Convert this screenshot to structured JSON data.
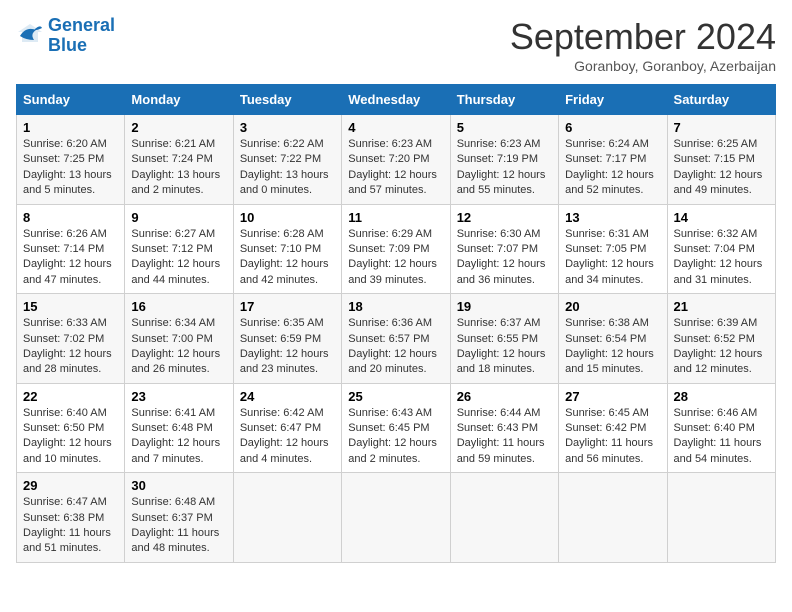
{
  "header": {
    "logo_general": "General",
    "logo_blue": "Blue",
    "month_title": "September 2024",
    "location": "Goranboy, Goranboy, Azerbaijan"
  },
  "days_of_week": [
    "Sunday",
    "Monday",
    "Tuesday",
    "Wednesday",
    "Thursday",
    "Friday",
    "Saturday"
  ],
  "weeks": [
    [
      {
        "day": "1",
        "sunrise": "Sunrise: 6:20 AM",
        "sunset": "Sunset: 7:25 PM",
        "daylight": "Daylight: 13 hours and 5 minutes."
      },
      {
        "day": "2",
        "sunrise": "Sunrise: 6:21 AM",
        "sunset": "Sunset: 7:24 PM",
        "daylight": "Daylight: 13 hours and 2 minutes."
      },
      {
        "day": "3",
        "sunrise": "Sunrise: 6:22 AM",
        "sunset": "Sunset: 7:22 PM",
        "daylight": "Daylight: 13 hours and 0 minutes."
      },
      {
        "day": "4",
        "sunrise": "Sunrise: 6:23 AM",
        "sunset": "Sunset: 7:20 PM",
        "daylight": "Daylight: 12 hours and 57 minutes."
      },
      {
        "day": "5",
        "sunrise": "Sunrise: 6:23 AM",
        "sunset": "Sunset: 7:19 PM",
        "daylight": "Daylight: 12 hours and 55 minutes."
      },
      {
        "day": "6",
        "sunrise": "Sunrise: 6:24 AM",
        "sunset": "Sunset: 7:17 PM",
        "daylight": "Daylight: 12 hours and 52 minutes."
      },
      {
        "day": "7",
        "sunrise": "Sunrise: 6:25 AM",
        "sunset": "Sunset: 7:15 PM",
        "daylight": "Daylight: 12 hours and 49 minutes."
      }
    ],
    [
      {
        "day": "8",
        "sunrise": "Sunrise: 6:26 AM",
        "sunset": "Sunset: 7:14 PM",
        "daylight": "Daylight: 12 hours and 47 minutes."
      },
      {
        "day": "9",
        "sunrise": "Sunrise: 6:27 AM",
        "sunset": "Sunset: 7:12 PM",
        "daylight": "Daylight: 12 hours and 44 minutes."
      },
      {
        "day": "10",
        "sunrise": "Sunrise: 6:28 AM",
        "sunset": "Sunset: 7:10 PM",
        "daylight": "Daylight: 12 hours and 42 minutes."
      },
      {
        "day": "11",
        "sunrise": "Sunrise: 6:29 AM",
        "sunset": "Sunset: 7:09 PM",
        "daylight": "Daylight: 12 hours and 39 minutes."
      },
      {
        "day": "12",
        "sunrise": "Sunrise: 6:30 AM",
        "sunset": "Sunset: 7:07 PM",
        "daylight": "Daylight: 12 hours and 36 minutes."
      },
      {
        "day": "13",
        "sunrise": "Sunrise: 6:31 AM",
        "sunset": "Sunset: 7:05 PM",
        "daylight": "Daylight: 12 hours and 34 minutes."
      },
      {
        "day": "14",
        "sunrise": "Sunrise: 6:32 AM",
        "sunset": "Sunset: 7:04 PM",
        "daylight": "Daylight: 12 hours and 31 minutes."
      }
    ],
    [
      {
        "day": "15",
        "sunrise": "Sunrise: 6:33 AM",
        "sunset": "Sunset: 7:02 PM",
        "daylight": "Daylight: 12 hours and 28 minutes."
      },
      {
        "day": "16",
        "sunrise": "Sunrise: 6:34 AM",
        "sunset": "Sunset: 7:00 PM",
        "daylight": "Daylight: 12 hours and 26 minutes."
      },
      {
        "day": "17",
        "sunrise": "Sunrise: 6:35 AM",
        "sunset": "Sunset: 6:59 PM",
        "daylight": "Daylight: 12 hours and 23 minutes."
      },
      {
        "day": "18",
        "sunrise": "Sunrise: 6:36 AM",
        "sunset": "Sunset: 6:57 PM",
        "daylight": "Daylight: 12 hours and 20 minutes."
      },
      {
        "day": "19",
        "sunrise": "Sunrise: 6:37 AM",
        "sunset": "Sunset: 6:55 PM",
        "daylight": "Daylight: 12 hours and 18 minutes."
      },
      {
        "day": "20",
        "sunrise": "Sunrise: 6:38 AM",
        "sunset": "Sunset: 6:54 PM",
        "daylight": "Daylight: 12 hours and 15 minutes."
      },
      {
        "day": "21",
        "sunrise": "Sunrise: 6:39 AM",
        "sunset": "Sunset: 6:52 PM",
        "daylight": "Daylight: 12 hours and 12 minutes."
      }
    ],
    [
      {
        "day": "22",
        "sunrise": "Sunrise: 6:40 AM",
        "sunset": "Sunset: 6:50 PM",
        "daylight": "Daylight: 12 hours and 10 minutes."
      },
      {
        "day": "23",
        "sunrise": "Sunrise: 6:41 AM",
        "sunset": "Sunset: 6:48 PM",
        "daylight": "Daylight: 12 hours and 7 minutes."
      },
      {
        "day": "24",
        "sunrise": "Sunrise: 6:42 AM",
        "sunset": "Sunset: 6:47 PM",
        "daylight": "Daylight: 12 hours and 4 minutes."
      },
      {
        "day": "25",
        "sunrise": "Sunrise: 6:43 AM",
        "sunset": "Sunset: 6:45 PM",
        "daylight": "Daylight: 12 hours and 2 minutes."
      },
      {
        "day": "26",
        "sunrise": "Sunrise: 6:44 AM",
        "sunset": "Sunset: 6:43 PM",
        "daylight": "Daylight: 11 hours and 59 minutes."
      },
      {
        "day": "27",
        "sunrise": "Sunrise: 6:45 AM",
        "sunset": "Sunset: 6:42 PM",
        "daylight": "Daylight: 11 hours and 56 minutes."
      },
      {
        "day": "28",
        "sunrise": "Sunrise: 6:46 AM",
        "sunset": "Sunset: 6:40 PM",
        "daylight": "Daylight: 11 hours and 54 minutes."
      }
    ],
    [
      {
        "day": "29",
        "sunrise": "Sunrise: 6:47 AM",
        "sunset": "Sunset: 6:38 PM",
        "daylight": "Daylight: 11 hours and 51 minutes."
      },
      {
        "day": "30",
        "sunrise": "Sunrise: 6:48 AM",
        "sunset": "Sunset: 6:37 PM",
        "daylight": "Daylight: 11 hours and 48 minutes."
      },
      {
        "day": "",
        "sunrise": "",
        "sunset": "",
        "daylight": ""
      },
      {
        "day": "",
        "sunrise": "",
        "sunset": "",
        "daylight": ""
      },
      {
        "day": "",
        "sunrise": "",
        "sunset": "",
        "daylight": ""
      },
      {
        "day": "",
        "sunrise": "",
        "sunset": "",
        "daylight": ""
      },
      {
        "day": "",
        "sunrise": "",
        "sunset": "",
        "daylight": ""
      }
    ]
  ]
}
